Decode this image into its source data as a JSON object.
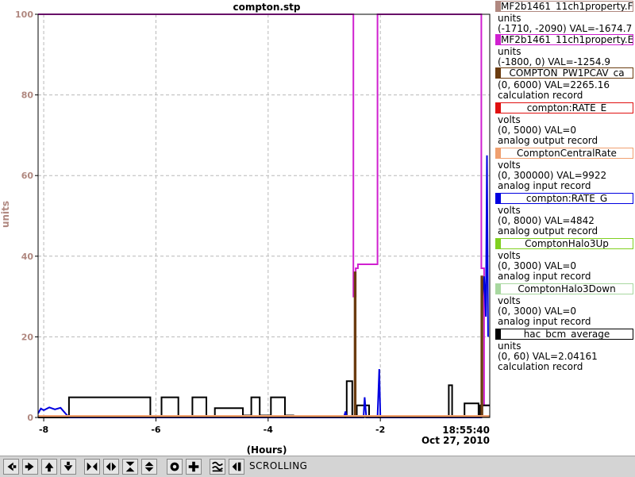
{
  "chart_data": {
    "type": "line",
    "title": "compton.stp",
    "xlabel": "(Hours)",
    "ylabel": "units",
    "xlim": [
      -8.1,
      -0.05
    ],
    "ylim": [
      0,
      100
    ],
    "grid": true,
    "x_ticks": [
      -8,
      -6,
      -4,
      -2
    ],
    "x_tick_labels": [
      "-8",
      "-6",
      "-4",
      "-2"
    ],
    "y_ticks": [
      0,
      20,
      40,
      60,
      80,
      100
    ],
    "y_tick_labels": [
      "0",
      "20",
      "40",
      "60",
      "80",
      "100"
    ],
    "time_label": "18:55:40",
    "date_label": "Oct 27, 2010",
    "series": [
      {
        "name": "MF2b1461_11ch1property.E",
        "color": "#d020d0",
        "x": [
          -8.1,
          -2.48,
          -2.48,
          -2.44,
          -2.44,
          -2.4,
          -2.4,
          -2.05,
          -2.05,
          -0.2,
          -0.2,
          -0.15,
          -0.15,
          -0.05
        ],
        "y": [
          100,
          100,
          30,
          30,
          37,
          37,
          38,
          38,
          100,
          100,
          37,
          37,
          3,
          3
        ]
      },
      {
        "name": "hac_bcm_average",
        "color": "#000000",
        "x": [
          -8.1,
          -7.55,
          -7.55,
          -6.1,
          -6.1,
          -5.9,
          -5.9,
          -5.6,
          -5.6,
          -5.35,
          -5.35,
          -5.1,
          -5.1,
          -4.95,
          -4.95,
          -4.45,
          -4.45,
          -4.3,
          -4.3,
          -4.15,
          -4.15,
          -3.95,
          -3.95,
          -3.7,
          -3.7,
          -3.55,
          -3.55,
          -2.6,
          -2.6,
          -2.5,
          -2.5,
          -2.42,
          -2.42,
          -2.2,
          -2.2,
          -2.0,
          -2.0,
          -0.78,
          -0.78,
          -0.72,
          -0.72,
          -0.5,
          -0.5,
          -0.25,
          -0.25,
          -0.22,
          -0.22,
          -0.05
        ],
        "y": [
          0,
          0,
          5,
          5,
          0,
          0,
          5,
          5,
          0,
          0,
          5,
          5,
          0,
          0,
          2.3,
          2.3,
          0.5,
          0.5,
          5,
          5,
          0.5,
          0.5,
          5,
          5,
          0.5,
          0.5,
          0,
          0,
          9,
          9,
          0,
          0,
          3,
          3,
          0,
          0,
          0,
          0,
          8,
          8,
          0,
          0,
          3.5,
          3.5,
          0,
          0,
          3,
          3
        ]
      },
      {
        "name": "compton:RATE_G",
        "color": "#0000e0",
        "x": [
          -8.1,
          -8.05,
          -8.0,
          -7.9,
          -7.8,
          -7.7,
          -7.55,
          -7.55,
          -2.65,
          -2.62,
          -2.6,
          -2.3,
          -2.28,
          -2.25,
          -2.05,
          -2.02,
          -2.0,
          -0.2,
          -0.18,
          -0.15,
          -0.12,
          -0.1,
          -0.08
        ],
        "y": [
          1,
          2.2,
          1.8,
          2.5,
          2,
          2.4,
          0,
          0,
          0,
          1.5,
          0,
          0,
          5,
          0,
          0,
          12,
          0,
          0,
          30,
          35,
          25,
          65,
          20
        ]
      },
      {
        "name": "COMPTON_PW1PCAV_ca",
        "color": "#6b3c10",
        "x": [
          -8.1,
          -2.46,
          -2.46,
          -2.44,
          -2.44,
          -0.2,
          -0.2,
          -0.18,
          -0.18,
          -0.05
        ],
        "y": [
          0.3,
          0.3,
          36,
          36,
          0.3,
          0.3,
          35,
          35,
          0.3,
          0.3
        ]
      },
      {
        "name": "ComptonCentralRate",
        "color": "#f0a070",
        "x": [
          -8.1,
          -0.05
        ],
        "y": [
          0.4,
          0.4
        ]
      }
    ]
  },
  "legend": [
    {
      "name": "MF2b1461_11ch1property.F",
      "color": "#b08880",
      "unit": "units",
      "range": "(-1710, -2090) VAL=-1674.7",
      "record": ""
    },
    {
      "name": "MF2b1461_11ch1property.E",
      "color": "#d020d0",
      "unit": "units",
      "range": "(-1800, 0) VAL=-1254.9",
      "record": ""
    },
    {
      "name": "COMPTON_PW1PCAV_ca",
      "color": "#6b3c10",
      "unit": "",
      "range": "(0, 6000) VAL=2265.16",
      "record": "calculation record"
    },
    {
      "name": "compton:RATE_E",
      "color": "#e01010",
      "unit": "volts",
      "range": "(0, 5000)  VAL=0",
      "record": "analog output record"
    },
    {
      "name": "ComptonCentralRate",
      "color": "#f0a070",
      "unit": "volts",
      "range": "(0, 300000) VAL=9922",
      "record": "analog input record"
    },
    {
      "name": "compton:RATE_G",
      "color": "#0000e0",
      "unit": "volts",
      "range": "(0, 8000) VAL=4842",
      "record": "analog output record"
    },
    {
      "name": "ComptonHalo3Up",
      "color": "#80d020",
      "unit": "volts",
      "range": "(0, 3000)  VAL=0",
      "record": "analog input record"
    },
    {
      "name": "ComptonHalo3Down",
      "color": "#a8d8a0",
      "unit": "volts",
      "range": "(0, 3000)  VAL=0",
      "record": "analog input record"
    },
    {
      "name": "hac_bcm_average",
      "color": "#000000",
      "unit": "units",
      "range": "(0, 60) VAL=2.04161",
      "record": "calculation record"
    }
  ],
  "toolbar": {
    "status": "SCROLLING",
    "buttons": [
      "pan-left-icon",
      "pan-right-icon",
      "pan-up-icon",
      "pan-down-icon",
      "zoom-in-x-icon",
      "zoom-out-x-icon",
      "zoom-in-y-icon",
      "zoom-out-y-icon",
      "autoscale-icon",
      "zoom-in-icon",
      "overlay-icon",
      "scroll-mode-icon"
    ]
  }
}
